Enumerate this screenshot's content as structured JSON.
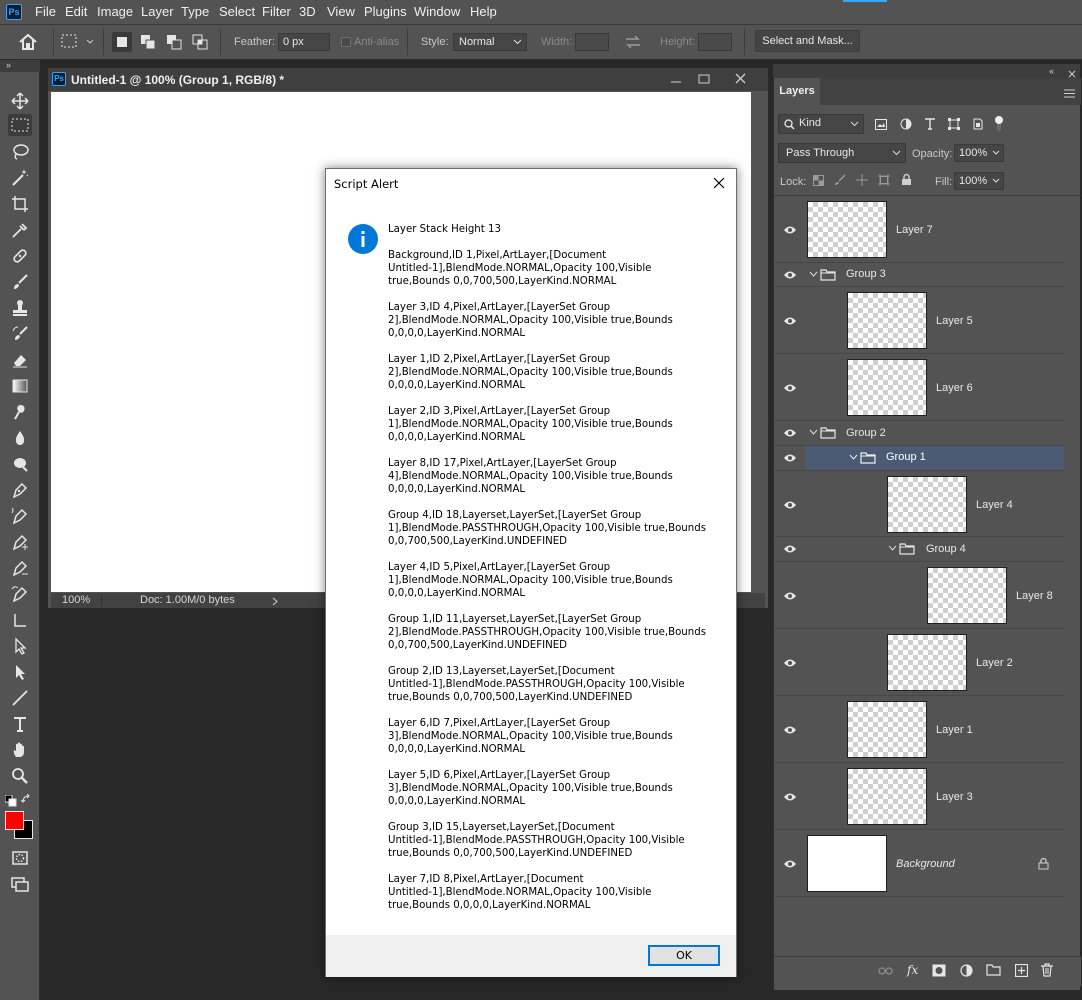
{
  "menubar": {
    "app_icon": "Ps",
    "items": [
      "File",
      "Edit",
      "Image",
      "Layer",
      "Type",
      "Select",
      "Filter",
      "3D",
      "View",
      "Plugins",
      "Window",
      "Help"
    ]
  },
  "options_bar": {
    "feather_label": "Feather:",
    "feather_value": "0 px",
    "antialias_label": "Anti-alias",
    "style_label": "Style:",
    "style_value": "Normal",
    "width_label": "Width:",
    "height_label": "Height:",
    "select_mask_label": "Select and Mask..."
  },
  "document": {
    "title": "Untitled-1 @ 100% (Group 1, RGB/8) *",
    "zoom": "100%",
    "doc_info": "Doc: 1.00M/0 bytes"
  },
  "layers_panel": {
    "tab": "Layers",
    "filter_kind": "Kind",
    "blend_mode": "Pass Through",
    "opacity_label": "Opacity:",
    "opacity_value": "100%",
    "lock_label": "Lock:",
    "fill_label": "Fill:",
    "fill_value": "100%",
    "layers": [
      {
        "name": "Layer 7"
      },
      {
        "name": "Group 3"
      },
      {
        "name": "Layer 5"
      },
      {
        "name": "Layer 6"
      },
      {
        "name": "Group 2"
      },
      {
        "name": "Group 1"
      },
      {
        "name": "Layer 4"
      },
      {
        "name": "Group 4"
      },
      {
        "name": "Layer 8"
      },
      {
        "name": "Layer 2"
      },
      {
        "name": "Layer 1"
      },
      {
        "name": "Layer 3"
      },
      {
        "name": "Background"
      }
    ]
  },
  "dialog": {
    "title": "Script Alert",
    "heading": "Layer Stack Height 13",
    "entries": [
      "Background,ID 1,Pixel,ArtLayer,[Document\nUntitled-1],BlendMode.NORMAL,Opacity 100,Visible\ntrue,Bounds 0,0,700,500,LayerKind.NORMAL",
      "Layer 3,ID 4,Pixel,ArtLayer,[LayerSet Group\n2],BlendMode.NORMAL,Opacity 100,Visible true,Bounds\n0,0,0,0,LayerKind.NORMAL",
      "Layer 1,ID 2,Pixel,ArtLayer,[LayerSet Group\n2],BlendMode.NORMAL,Opacity 100,Visible true,Bounds\n0,0,0,0,LayerKind.NORMAL",
      "Layer 2,ID 3,Pixel,ArtLayer,[LayerSet Group\n1],BlendMode.NORMAL,Opacity 100,Visible true,Bounds\n0,0,0,0,LayerKind.NORMAL",
      "Layer 8,ID 17,Pixel,ArtLayer,[LayerSet Group\n4],BlendMode.NORMAL,Opacity 100,Visible true,Bounds\n0,0,0,0,LayerKind.NORMAL",
      "Group 4,ID 18,Layerset,LayerSet,[LayerSet Group\n1],BlendMode.PASSTHROUGH,Opacity 100,Visible true,Bounds\n0,0,700,500,LayerKind.UNDEFINED",
      "Layer 4,ID 5,Pixel,ArtLayer,[LayerSet Group\n1],BlendMode.NORMAL,Opacity 100,Visible true,Bounds\n0,0,0,0,LayerKind.NORMAL",
      "Group 1,ID 11,Layerset,LayerSet,[LayerSet Group\n2],BlendMode.PASSTHROUGH,Opacity 100,Visible true,Bounds\n0,0,700,500,LayerKind.UNDEFINED",
      "Group 2,ID 13,Layerset,LayerSet,[Document\nUntitled-1],BlendMode.PASSTHROUGH,Opacity 100,Visible\ntrue,Bounds 0,0,700,500,LayerKind.UNDEFINED",
      "Layer 6,ID 7,Pixel,ArtLayer,[LayerSet Group\n3],BlendMode.NORMAL,Opacity 100,Visible true,Bounds\n0,0,0,0,LayerKind.NORMAL",
      "Layer 5,ID 6,Pixel,ArtLayer,[LayerSet Group\n3],BlendMode.NORMAL,Opacity 100,Visible true,Bounds\n0,0,0,0,LayerKind.NORMAL",
      "Group 3,ID 15,Layerset,LayerSet,[Document\nUntitled-1],BlendMode.PASSTHROUGH,Opacity 100,Visible\ntrue,Bounds 0,0,700,500,LayerKind.UNDEFINED",
      "Layer 7,ID 8,Pixel,ArtLayer,[Document\nUntitled-1],BlendMode.NORMAL,Opacity 100,Visible\ntrue,Bounds 0,0,0,0,LayerKind.NORMAL"
    ],
    "ok_label": "OK"
  },
  "colors": {
    "foreground": "#ff0000",
    "background": "#000000",
    "selection": "#4b5b74",
    "info_icon": "#0078d7"
  }
}
